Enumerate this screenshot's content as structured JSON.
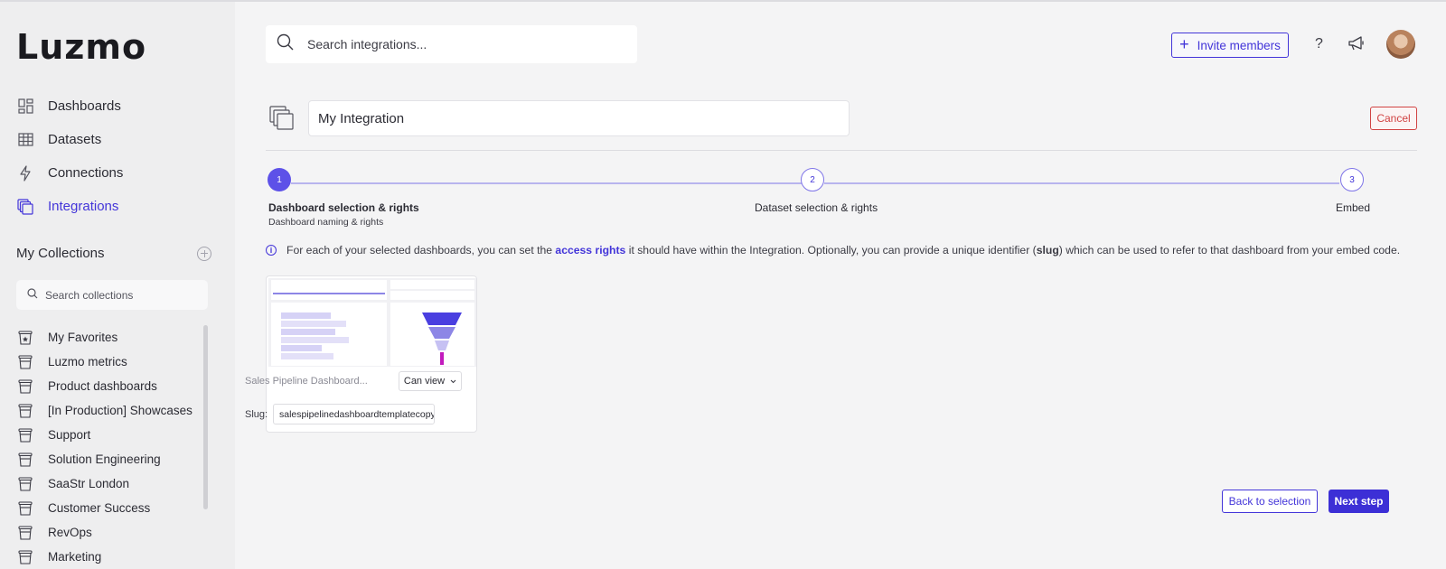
{
  "app": {
    "logo": "Luzmo"
  },
  "sidebar": {
    "nav": [
      {
        "label": "Dashboards",
        "icon": "dashboards-icon"
      },
      {
        "label": "Datasets",
        "icon": "datasets-icon"
      },
      {
        "label": "Connections",
        "icon": "connections-icon"
      },
      {
        "label": "Integrations",
        "icon": "integrations-icon",
        "active": true
      }
    ],
    "collections_title": "My Collections",
    "collections_search_placeholder": "Search collections",
    "collections": [
      {
        "label": "My Favorites"
      },
      {
        "label": "Luzmo metrics"
      },
      {
        "label": "Product dashboards"
      },
      {
        "label": "[In Production] Showcases"
      },
      {
        "label": "Support"
      },
      {
        "label": "Solution Engineering"
      },
      {
        "label": "SaaStr London"
      },
      {
        "label": "Customer Success"
      },
      {
        "label": "RevOps"
      },
      {
        "label": "Marketing"
      }
    ]
  },
  "header": {
    "search_placeholder": "Search integrations...",
    "invite_label": "Invite members",
    "help_label": "?"
  },
  "integration": {
    "name": "My Integration",
    "cancel_label": "Cancel"
  },
  "stepper": {
    "steps": [
      {
        "number": "1",
        "label": "Dashboard selection & rights",
        "sub": "Dashboard naming & rights"
      },
      {
        "number": "2",
        "label": "Dataset selection & rights"
      },
      {
        "number": "3",
        "label": "Embed"
      }
    ]
  },
  "info": {
    "part1": "For each of your selected dashboards, you can set the ",
    "link": "access rights",
    "part2": " it should have within the Integration. Optionally, you can provide a unique identifier (",
    "bold": "slug",
    "part3": ") which can be used to refer to that dashboard from your embed code."
  },
  "dashboard_card": {
    "name": "Sales Pipeline Dashboard...",
    "permission": "Can view",
    "slug_label": "Slug:",
    "slug_value": "salespipelinedashboardtemplatecopy"
  },
  "footer": {
    "back_label": "Back to selection",
    "next_label": "Next step"
  },
  "colors": {
    "accent": "#4335d9",
    "step_active": "#5d51e8",
    "cancel": "#d14343"
  }
}
